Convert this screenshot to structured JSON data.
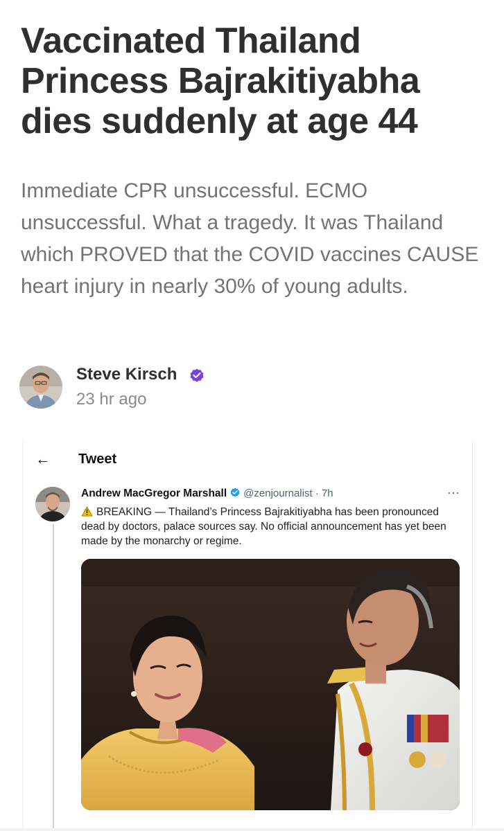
{
  "article": {
    "title": "Vaccinated Thailand Princess Bajrakitiyabha dies suddenly at age 44",
    "subtitle": "Immediate CPR unsuccessful. ECMO unsuccessful. What a tragedy. It was Thailand which PROVED that the COVID vaccines CAUSE heart injury in nearly 30% of young adults.",
    "author": {
      "name": "Steve Kirsch",
      "time": "23 hr ago",
      "verified_color": "#7b3fe4"
    }
  },
  "tweet": {
    "header_title": "Tweet",
    "back_icon": "arrow-left-icon",
    "author_name": "Andrew MacGregor Marshall",
    "handle": "@zenjournalist · 7h",
    "verified_color": "#1d9bf0",
    "more_label": "···",
    "text": "BREAKING — Thailand’s Princess Bajrakitiyabha has been pronounced dead by doctors, palace sources say. No official announcement has yet been made by the monarchy or regime.",
    "warning_icon": "warning-icon",
    "photo_icon": "tweet-photo"
  },
  "colors": {
    "title": "#2f2f2f",
    "subtitle": "#737373",
    "tweet_text": "#222222",
    "handle": "#536471",
    "thread_line": "#d0d4d8"
  }
}
